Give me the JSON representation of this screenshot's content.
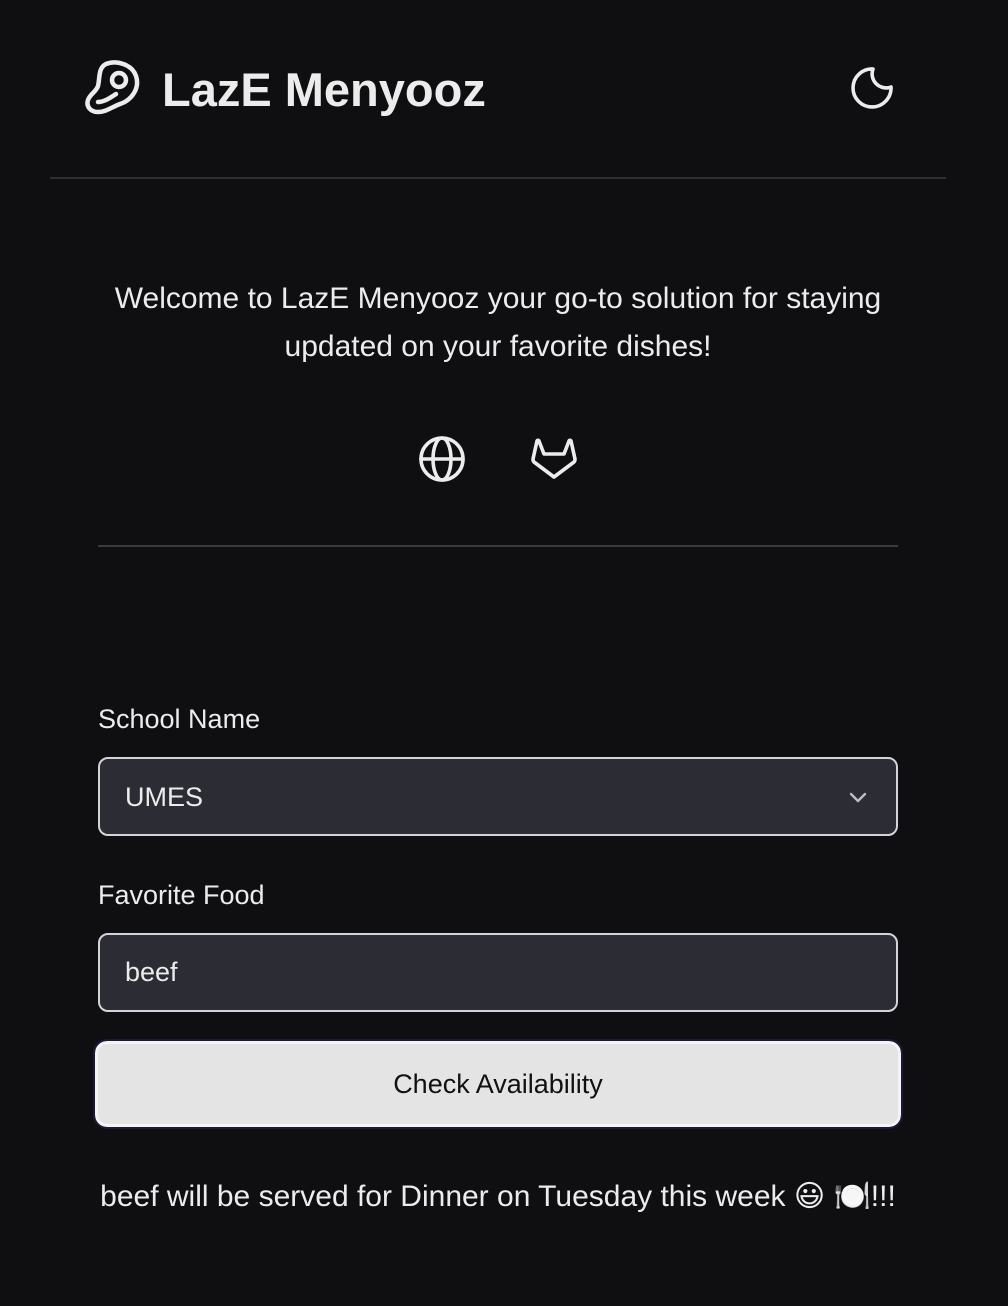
{
  "header": {
    "title": "LazE Menyooz",
    "logo_icon": "meat-steak-icon",
    "theme_toggle_icon": "moon-icon"
  },
  "intro": {
    "welcome_text": "Welcome to LazE Menyooz your go-to solution for staying updated on your favorite dishes!"
  },
  "links": [
    {
      "icon": "globe-icon"
    },
    {
      "icon": "gitlab-icon"
    }
  ],
  "form": {
    "school_label": "School Name",
    "school_value": "UMES",
    "food_label": "Favorite Food",
    "food_value": "beef",
    "submit_label": "Check Availability"
  },
  "result": {
    "message": "beef will be served for Dinner on Tuesday this week 😃 🍽️!!!"
  }
}
